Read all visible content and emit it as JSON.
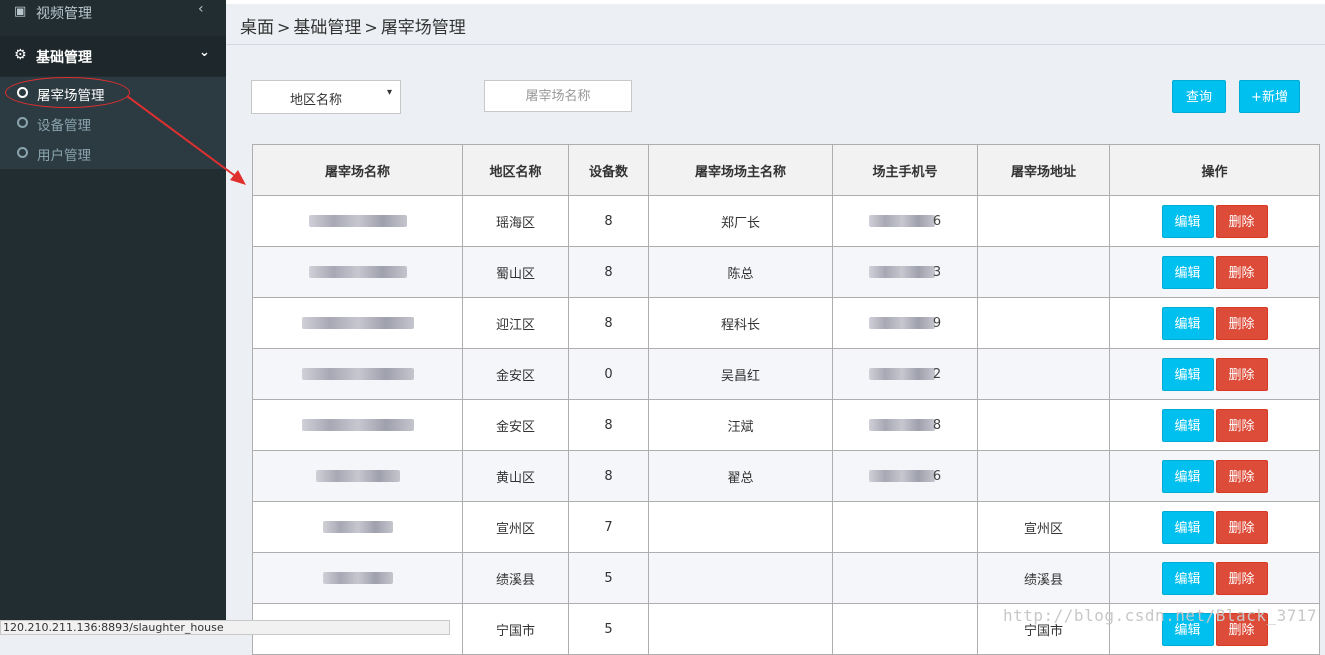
{
  "sidebar": {
    "top_item": {
      "label": "视频管理",
      "icon": "film-icon",
      "chevron": "‹"
    },
    "section": {
      "label": "基础管理",
      "icon": "gear-icon",
      "chevron": "⌄"
    },
    "items": [
      {
        "label": "屠宰场管理",
        "active": true
      },
      {
        "label": "设备管理",
        "active": false
      },
      {
        "label": "用户管理",
        "active": false
      }
    ]
  },
  "breadcrumb": [
    "桌面",
    "基础管理",
    "屠宰场管理"
  ],
  "breadcrumb_separator": ">",
  "filters": {
    "region_select": {
      "value": "地区名称",
      "caret": "▾"
    },
    "name_input": {
      "placeholder": "屠宰场名称",
      "value": ""
    }
  },
  "buttons": {
    "query": "查询",
    "add": "+新增"
  },
  "table": {
    "headers": [
      "屠宰场名称",
      "地区名称",
      "设备数",
      "屠宰场场主名称",
      "场主手机号",
      "屠宰场地址",
      "操作"
    ],
    "rows": [
      {
        "name": "",
        "region": "瑶海区",
        "devices": "8",
        "owner": "郑厂长",
        "phone_end": "6",
        "address": ""
      },
      {
        "name": "",
        "region": "蜀山区",
        "devices": "8",
        "owner": "陈总",
        "phone_end": "3",
        "address": ""
      },
      {
        "name": "",
        "region": "迎江区",
        "devices": "8",
        "owner": "程科长",
        "phone_end": "9",
        "address": ""
      },
      {
        "name": "",
        "region": "金安区",
        "devices": "0",
        "owner": "吴昌红",
        "phone_end": "2",
        "address": ""
      },
      {
        "name": "",
        "region": "金安区",
        "devices": "8",
        "owner": "汪斌",
        "phone_end": "8",
        "address": ""
      },
      {
        "name": "",
        "region": "黄山区",
        "devices": "8",
        "owner": "翟总",
        "phone_end": "6",
        "address": ""
      },
      {
        "name": "",
        "region": "宣州区",
        "devices": "7",
        "owner": "",
        "phone_end": "",
        "address": "宣州区"
      },
      {
        "name": "",
        "region": "绩溪县",
        "devices": "5",
        "owner": "",
        "phone_end": "",
        "address": "绩溪县"
      },
      {
        "name": "",
        "region": "宁国市",
        "devices": "5",
        "owner": "",
        "phone_end": "",
        "address": "宁国市"
      }
    ],
    "edit_label": "编辑",
    "delete_label": "删除"
  },
  "status_bar": "120.210.211.136:8893/slaughter_house",
  "watermark": "http://blog.csdn.net/Black_3717",
  "colors": {
    "sidebar_bg": "#222d32",
    "primary_button": "#00c0ef",
    "danger_button": "#dd4b39",
    "annotation_red": "#e02f2f"
  }
}
